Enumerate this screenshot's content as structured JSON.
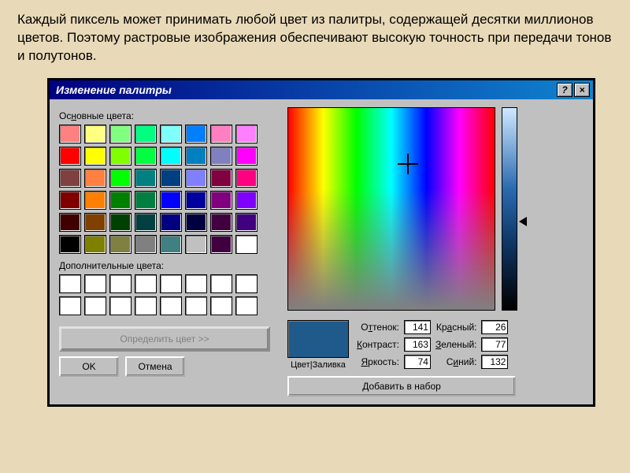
{
  "description": "Каждый пиксель может принимать любой цвет из палитры, содержащей десятки миллионов цветов. Поэтому растровые изображения обеспечивают высокую точность при передачи тонов и полутонов.",
  "dialog": {
    "title": "Изменение палитры",
    "help_btn": "?",
    "close_btn": "×"
  },
  "labels": {
    "basic_colors": "Основные цвета:",
    "custom_colors": "Дополнительные цвета:",
    "define_color": "Определить цвет >>",
    "ok": "OK",
    "cancel": "Отмена",
    "preview": "Цвет|Заливка",
    "add_to_custom": "Добавить в набор"
  },
  "fields": {
    "hue_label": "Оттенок:",
    "hue": "141",
    "sat_label": "Контраст:",
    "sat": "163",
    "lum_label": "Яркость:",
    "lum": "74",
    "red_label": "Красный:",
    "red": "26",
    "green_label": "Зеленый:",
    "green": "77",
    "blue_label": "Синий:",
    "blue": "132"
  },
  "basic_colors": [
    "#ff8080",
    "#ffff80",
    "#80ff80",
    "#00ff80",
    "#80ffff",
    "#0080ff",
    "#ff80c0",
    "#ff80ff",
    "#ff0000",
    "#ffff00",
    "#80ff00",
    "#00ff40",
    "#00ffff",
    "#0080c0",
    "#8080c0",
    "#ff00ff",
    "#804040",
    "#ff8040",
    "#00ff00",
    "#008080",
    "#004080",
    "#8080ff",
    "#800040",
    "#ff0080",
    "#800000",
    "#ff8000",
    "#008000",
    "#008040",
    "#0000ff",
    "#0000a0",
    "#800080",
    "#8000ff",
    "#400000",
    "#804000",
    "#004000",
    "#004040",
    "#000080",
    "#000040",
    "#400040",
    "#400080",
    "#000000",
    "#808000",
    "#808040",
    "#808080",
    "#408080",
    "#c0c0c0",
    "#400040",
    "#ffffff"
  ],
  "custom_slots": 16,
  "preview_color": "#1f5a8a"
}
